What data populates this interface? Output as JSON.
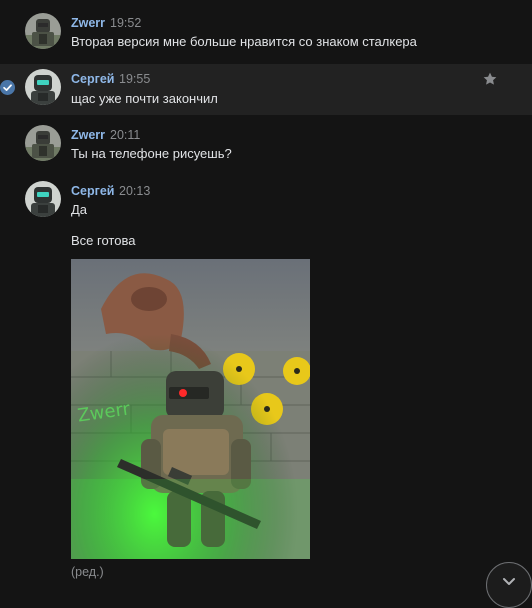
{
  "messages": [
    {
      "author": "Zwerr",
      "time": "19:52",
      "lines": [
        "Вторая версия мне больше нравится со знаком сталкера"
      ]
    },
    {
      "author": "Сергей",
      "time": "19:55",
      "lines": [
        "щас уже почти закончил"
      ]
    },
    {
      "author": "Zwerr",
      "time": "20:11",
      "lines": [
        "Ты на телефоне рисуешь?"
      ]
    },
    {
      "author": "Сергей",
      "time": "20:13",
      "lines": [
        "Да",
        "Все готова"
      ],
      "attachment": {
        "type": "image",
        "art_text": "Zwerr"
      },
      "edited_label": "(ред.)"
    }
  ],
  "icons": {
    "selected": "check-circle-icon",
    "favorite": "star-icon",
    "scroll": "chevron-down-icon"
  },
  "colors": {
    "background": "#141414",
    "selected_row": "#222222",
    "author": "#8fb8e8",
    "accent": "#4a76a8"
  }
}
